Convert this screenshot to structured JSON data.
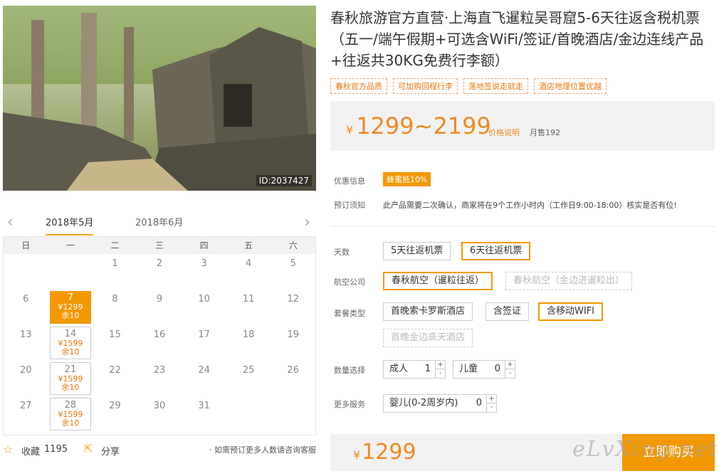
{
  "photo": {
    "id_label": "ID:2037427"
  },
  "calendar": {
    "tabs": [
      "2018年5月",
      "2018年6月"
    ],
    "weekdays": [
      "日",
      "一",
      "二",
      "三",
      "四",
      "五",
      "六"
    ],
    "rows": [
      [
        {
          "d": ""
        },
        {
          "d": ""
        },
        {
          "d": "1"
        },
        {
          "d": "2"
        },
        {
          "d": "3"
        },
        {
          "d": "4"
        },
        {
          "d": "5"
        }
      ],
      [
        {
          "d": "6"
        },
        {
          "d": "7",
          "p": "¥1299",
          "s": "余10",
          "sel": true
        },
        {
          "d": "8"
        },
        {
          "d": "9"
        },
        {
          "d": "10"
        },
        {
          "d": "11"
        },
        {
          "d": "12"
        }
      ],
      [
        {
          "d": "13"
        },
        {
          "d": "14",
          "p": "¥1599",
          "s": "余10"
        },
        {
          "d": "15"
        },
        {
          "d": "16"
        },
        {
          "d": "17"
        },
        {
          "d": "18"
        },
        {
          "d": "19"
        }
      ],
      [
        {
          "d": "20"
        },
        {
          "d": "21",
          "p": "¥1599",
          "s": "余10"
        },
        {
          "d": "22"
        },
        {
          "d": "23"
        },
        {
          "d": "24"
        },
        {
          "d": "25"
        },
        {
          "d": "26"
        }
      ],
      [
        {
          "d": "27"
        },
        {
          "d": "28",
          "p": "¥1599",
          "s": "余10"
        },
        {
          "d": "29"
        },
        {
          "d": "30"
        },
        {
          "d": "31"
        },
        {
          "d": ""
        },
        {
          "d": ""
        }
      ]
    ]
  },
  "footer": {
    "fav_label": "收藏",
    "fav_count": "1195",
    "share_label": "分享",
    "consult": "· 如需预订更多人数请咨询客服"
  },
  "product": {
    "title": "春秋旅游官方直营·上海直飞暹粒吴哥窟5-6天往返含税机票（五一/端午假期+可选含WiFi/签证/首晚酒店/金边连线产品+往返共30KG免费行李额）",
    "tags": [
      "春秋官方品质",
      "可加购回程行李",
      "落地签说走就走",
      "酒店地理位置优越"
    ],
    "price_range": "1299~2199",
    "yen": "¥",
    "price_note": "价格说明",
    "sales": "月售192",
    "discount_label": "优惠信息",
    "discount_badge": "蜂蜜抵10%",
    "notice_label": "预订须知",
    "notice_text": "此产品需要二次确认，商家将在9个工作小时内（工作日9:00-18:00）核实是否有位!"
  },
  "options": {
    "days_label": "天数",
    "days": [
      "5天往返机票",
      "6天往返机票"
    ],
    "airline_label": "航空公司",
    "airlines": [
      "春秋航空（暹粒往返）",
      "春秋航空（金边进暹粒出）"
    ],
    "package_label": "套餐类型",
    "packages": [
      "首晚索卡罗斯酒店",
      "含签证",
      "含移动WIFI",
      "首晚金边高天酒店"
    ],
    "qty_label": "数量选择",
    "adult_label": "成人",
    "adult_val": "1",
    "child_label": "儿童",
    "child_val": "0",
    "more_label": "更多服务",
    "infant_label": "婴儿(0-2周岁内)",
    "infant_val": "0",
    "plus": "+",
    "minus": "-"
  },
  "bottom": {
    "price": "1299",
    "buy_label": "立即购买"
  },
  "watermark": "eLvXing.net"
}
